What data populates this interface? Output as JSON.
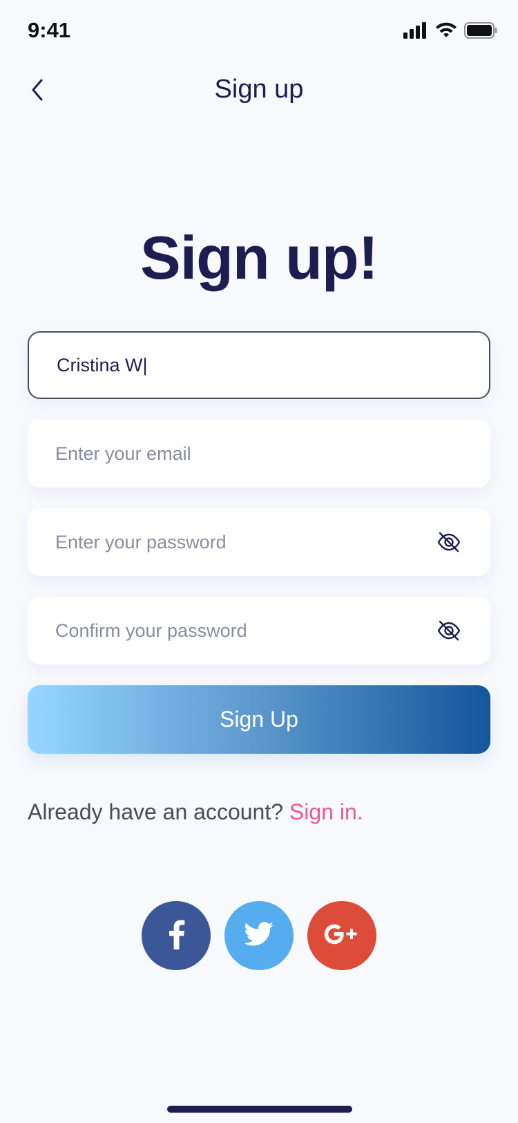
{
  "status_bar": {
    "time": "9:41"
  },
  "nav": {
    "title": "Sign up",
    "back_icon": "chevron-left-icon"
  },
  "heading": "Sign up!",
  "fields": {
    "name": {
      "value": "Cristina W|"
    },
    "email": {
      "placeholder": "Enter your email"
    },
    "password": {
      "placeholder": "Enter your password",
      "icon": "eye-off-icon"
    },
    "confirm_password": {
      "placeholder": "Confirm your password",
      "icon": "eye-off-icon"
    }
  },
  "primary_button": {
    "label": "Sign Up"
  },
  "signin_prompt": {
    "text": "Already have an account? ",
    "link": "Sign in."
  },
  "social": {
    "facebook": {
      "icon": "facebook-icon",
      "color": "#3b5797"
    },
    "twitter": {
      "icon": "twitter-icon",
      "color": "#55acee"
    },
    "google_plus": {
      "icon": "google-plus-icon",
      "label": "G+",
      "color": "#dd4b39"
    }
  },
  "colors": {
    "primary_text": "#1d1d52",
    "accent_link": "#ef5a8a",
    "background": "#f8f9fd"
  }
}
